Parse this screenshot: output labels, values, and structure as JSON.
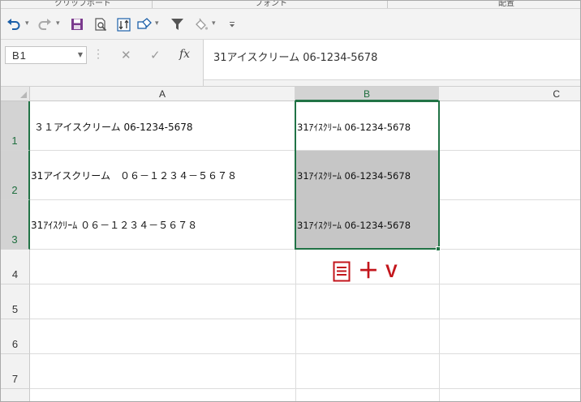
{
  "ribbon": {
    "groups": [
      "クリップボード",
      "フォント",
      "配置"
    ]
  },
  "quick_access": {
    "buttons": [
      {
        "name": "undo",
        "icon": "undo-icon"
      },
      {
        "name": "redo",
        "icon": "redo-icon"
      },
      {
        "name": "save",
        "icon": "save-icon"
      },
      {
        "name": "print-preview",
        "icon": "print-preview-icon"
      },
      {
        "name": "sort",
        "icon": "sort-icon"
      },
      {
        "name": "shapes",
        "icon": "shapes-icon"
      },
      {
        "name": "filter",
        "icon": "filter-icon"
      },
      {
        "name": "fill-color",
        "icon": "paint-bucket-icon"
      },
      {
        "name": "customize",
        "icon": "customize-icon"
      }
    ]
  },
  "formula_bar": {
    "name_box": "B1",
    "cancel_glyph": "✕",
    "enter_glyph": "✓",
    "fx_glyph": "fx",
    "formula": "31アイスクリーム 06-1234-5678"
  },
  "sheet": {
    "columns": [
      "A",
      "B",
      "C"
    ],
    "rows": [
      "1",
      "2",
      "3",
      "4",
      "5",
      "6",
      "7"
    ],
    "selected_column": "B",
    "selected_rows": [
      "1",
      "2",
      "3"
    ],
    "cells": {
      "A1": "３１アイスクリーム 06-1234-5678",
      "A2": "31アイスクリーム　０６－１２３４－５６７８",
      "A3": "31ｱｲｽｸﾘｰﾑ ０６－１２３４－５６７８",
      "B1": "31ｱｲｽｸﾘｰﾑ 06-1234-5678",
      "B2": "31ｱｲｽｸﾘｰﾑ 06-1234-5678",
      "B3": "31ｱｲｽｸﾘｰﾑ 06-1234-5678"
    }
  },
  "paste_hint": {
    "icon": "clipboard-icon",
    "plus": "＋",
    "key": "V"
  },
  "colors": {
    "selection": "#217346",
    "highlight_fill": "#c6c6c6",
    "hint": "#c3161c"
  }
}
